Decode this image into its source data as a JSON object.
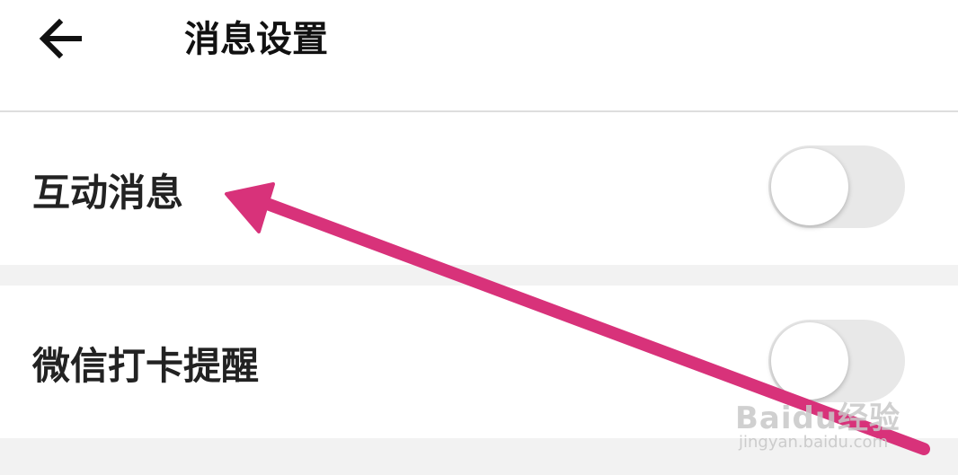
{
  "header": {
    "back_icon": "arrow-left-icon",
    "title": "消息设置"
  },
  "settings": [
    {
      "label": "互动消息",
      "enabled": false
    },
    {
      "label": "微信打卡提醒",
      "enabled": false
    }
  ],
  "annotation": {
    "arrow_color": "#d8327a"
  },
  "watermark": {
    "brand": "Baidu经验",
    "url": "jingyan.baidu.com"
  }
}
